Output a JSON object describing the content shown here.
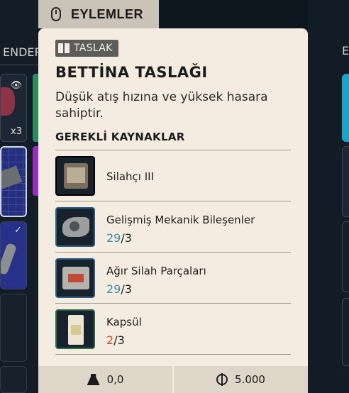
{
  "actions_tab": {
    "label": "EYLEMLER",
    "icon": "mouse-icon"
  },
  "background": {
    "left_label": "ENDER",
    "right_label": "E",
    "slot_quantity": "x3",
    "slot_icons": [
      "eye-icon",
      "check-icon"
    ]
  },
  "tooltip": {
    "badge": {
      "icon": "book-icon",
      "label": "TASLAK"
    },
    "title": "BETTİNA TASLAĞI",
    "description": "Düşük atış hızına ve yüksek hasara sahiptir.",
    "requirements_heading": "GEREKLİ KAYNAKLAR",
    "requirements": [
      {
        "name": "Silahçı III",
        "icon": "gunsmith-case-icon"
      },
      {
        "name": "Gelişmiş Mekanik Bileşenler",
        "have": "29",
        "sep": "/",
        "need": "3",
        "icon": "mechanical-parts-icon"
      },
      {
        "name": "Ağır Silah Parçaları",
        "have": "29",
        "sep": "/",
        "need": "3",
        "icon": "weapon-parts-crate-icon"
      },
      {
        "name": "Kapsül",
        "have": "2",
        "sep": "/",
        "need": "3",
        "icon": "capsule-box-icon"
      }
    ],
    "footer": {
      "weight": {
        "icon": "weight-icon",
        "value": "0,0"
      },
      "price": {
        "icon": "coin-icon",
        "value": "5.000"
      }
    }
  },
  "colors": {
    "have_sufficient": "#3f8ea8",
    "have_insufficient": "#d04a2b",
    "card_background": "#f4ece0"
  }
}
